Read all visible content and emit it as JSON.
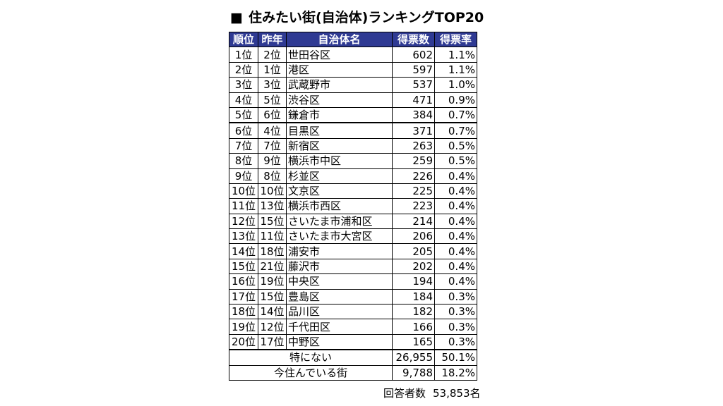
{
  "title": {
    "bullet": "■",
    "text": "住みたい街(自治体)ランキングTOP20"
  },
  "table": {
    "headers": [
      "順位",
      "昨年",
      "自治体名",
      "得票数",
      "得票率"
    ],
    "rows": [
      {
        "rank": "1位",
        "prev": "2位",
        "city": "世田谷区",
        "votes": "602",
        "rate": "1.1%"
      },
      {
        "rank": "2位",
        "prev": "1位",
        "city": "港区",
        "votes": "597",
        "rate": "1.1%"
      },
      {
        "rank": "3位",
        "prev": "3位",
        "city": "武蔵野市",
        "votes": "537",
        "rate": "1.0%"
      },
      {
        "rank": "4位",
        "prev": "5位",
        "city": "渋谷区",
        "votes": "471",
        "rate": "0.9%"
      },
      {
        "rank": "5位",
        "prev": "6位",
        "city": "鎌倉市",
        "votes": "384",
        "rate": "0.7%"
      },
      {
        "rank": "6位",
        "prev": "4位",
        "city": "目黒区",
        "votes": "371",
        "rate": "0.7%"
      },
      {
        "rank": "7位",
        "prev": "7位",
        "city": "新宿区",
        "votes": "263",
        "rate": "0.5%"
      },
      {
        "rank": "8位",
        "prev": "9位",
        "city": "横浜市中区",
        "votes": "259",
        "rate": "0.5%"
      },
      {
        "rank": "9位",
        "prev": "8位",
        "city": "杉並区",
        "votes": "226",
        "rate": "0.4%"
      },
      {
        "rank": "10位",
        "prev": "10位",
        "city": "文京区",
        "votes": "225",
        "rate": "0.4%"
      },
      {
        "rank": "11位",
        "prev": "13位",
        "city": "横浜市西区",
        "votes": "223",
        "rate": "0.4%"
      },
      {
        "rank": "12位",
        "prev": "15位",
        "city": "さいたま市浦和区",
        "votes": "214",
        "rate": "0.4%"
      },
      {
        "rank": "13位",
        "prev": "11位",
        "city": "さいたま市大宮区",
        "votes": "206",
        "rate": "0.4%"
      },
      {
        "rank": "14位",
        "prev": "18位",
        "city": "浦安市",
        "votes": "205",
        "rate": "0.4%"
      },
      {
        "rank": "15位",
        "prev": "21位",
        "city": "藤沢市",
        "votes": "202",
        "rate": "0.4%"
      },
      {
        "rank": "16位",
        "prev": "19位",
        "city": "中央区",
        "votes": "194",
        "rate": "0.4%"
      },
      {
        "rank": "17位",
        "prev": "15位",
        "city": "豊島区",
        "votes": "184",
        "rate": "0.3%"
      },
      {
        "rank": "18位",
        "prev": "14位",
        "city": "品川区",
        "votes": "182",
        "rate": "0.3%"
      },
      {
        "rank": "19位",
        "prev": "12位",
        "city": "千代田区",
        "votes": "166",
        "rate": "0.3%"
      },
      {
        "rank": "20位",
        "prev": "17位",
        "city": "中野区",
        "votes": "165",
        "rate": "0.3%"
      }
    ],
    "summary": [
      {
        "label": "特にない",
        "votes": "26,955",
        "rate": "50.1%"
      },
      {
        "label": "今住んでいる街",
        "votes": "9,788",
        "rate": "18.2%"
      }
    ]
  },
  "respondents": {
    "label": "回答者数",
    "value": "53,853名"
  },
  "colors": {
    "header_bg": "#2f3a93",
    "header_text": "#ffffff"
  }
}
